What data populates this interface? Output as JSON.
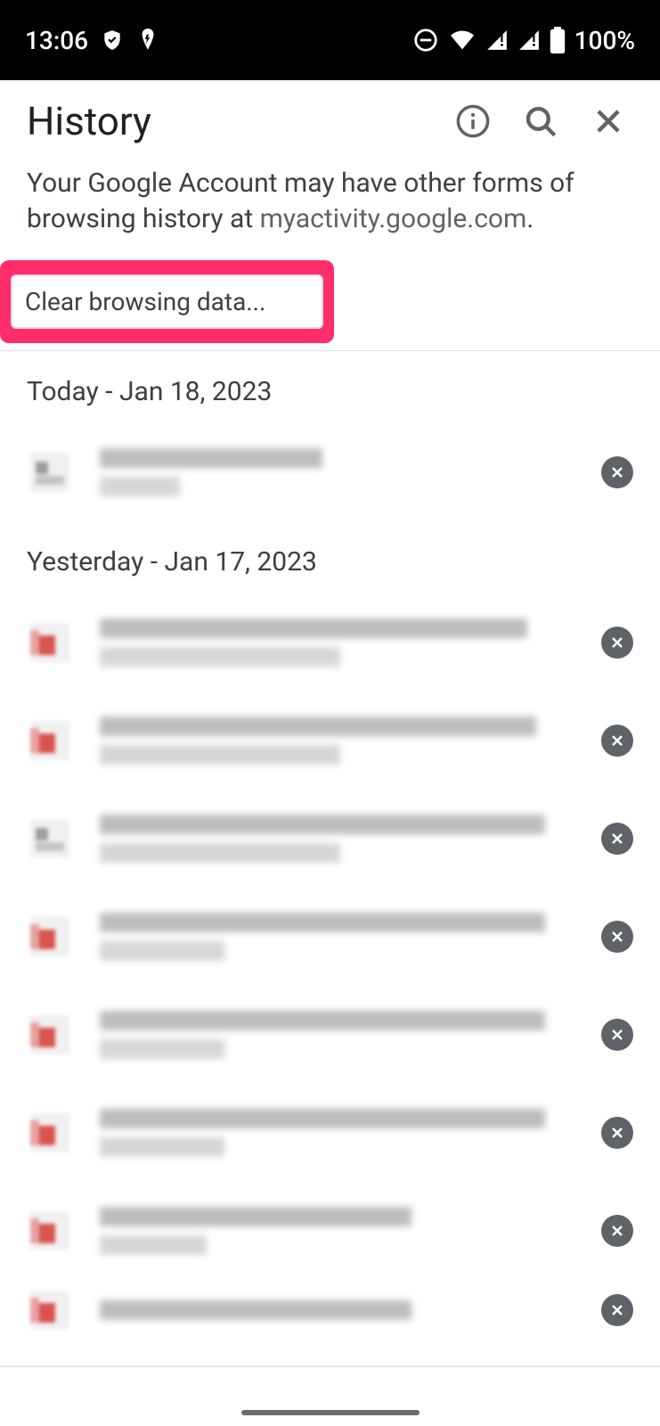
{
  "status": {
    "time": "13:06",
    "battery": "100%"
  },
  "header": {
    "title": "History"
  },
  "info": {
    "prefix": "Your Google Account may have other forms of browsing history at ",
    "link": "myactivity.google.com",
    "suffix": "."
  },
  "clear_button_label": "Clear browsing data...",
  "sections": {
    "today": "Today - Jan 18, 2023",
    "yesterday": "Yesterday - Jan 17, 2023"
  }
}
